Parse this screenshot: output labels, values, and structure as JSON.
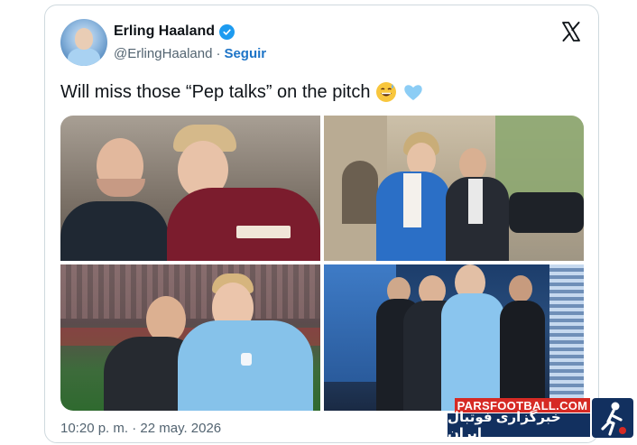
{
  "tweet": {
    "author_name": "Erling Haaland",
    "author_handle": "@ErlingHaaland",
    "separator": "·",
    "follow_label": "Seguir",
    "text": "Will miss those “Pep talks” on the pitch",
    "emojis": [
      "grinning-sweat-emoji",
      "light-blue-heart-emoji"
    ],
    "timestamp": "10:20 p. m. · 22 may. 2026",
    "photo_count": 4
  },
  "watermark": {
    "site": "PARSFOOTBALL.COM",
    "site_persian": "خبرگزاری فوتبال ایران"
  },
  "colors": {
    "verified": "#1d9bf0",
    "follow_link": "#1d74c7",
    "text_primary": "#0f1419",
    "text_secondary": "#536471",
    "watermark_red": "#d62a24",
    "watermark_navy": "#12305f"
  }
}
